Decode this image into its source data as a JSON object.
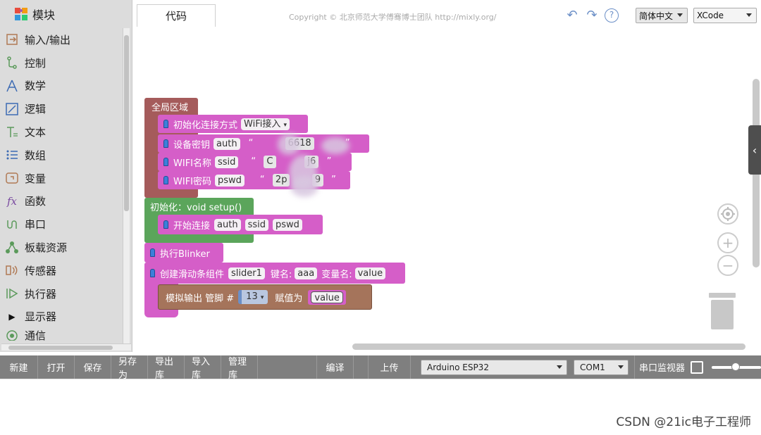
{
  "sidebar": {
    "title": "模块",
    "items": [
      {
        "label": "输入/输出",
        "icon": "input-output-icon"
      },
      {
        "label": "控制",
        "icon": "control-icon"
      },
      {
        "label": "数学",
        "icon": "math-icon"
      },
      {
        "label": "逻辑",
        "icon": "logic-icon"
      },
      {
        "label": "文本",
        "icon": "text-icon"
      },
      {
        "label": "数组",
        "icon": "array-icon"
      },
      {
        "label": "变量",
        "icon": "variable-icon"
      },
      {
        "label": "函数",
        "icon": "function-icon"
      },
      {
        "label": "串口",
        "icon": "serial-icon"
      },
      {
        "label": "板载资源",
        "icon": "board-resource-icon"
      },
      {
        "label": "传感器",
        "icon": "sensor-icon"
      },
      {
        "label": "执行器",
        "icon": "actuator-icon"
      },
      {
        "label": "显示器",
        "icon": "display-icon"
      },
      {
        "label": "通信",
        "icon": "communication-icon"
      }
    ]
  },
  "topbar": {
    "tab_code": "代码",
    "copyright": "Copyright © 北京师范大学傅骞博士团队 http://mixly.org/",
    "language": "简体中文",
    "theme": "XCode"
  },
  "blocks": {
    "global_area": "全局区域",
    "init_conn": "初始化连接方式",
    "init_conn_value": "WiFi接入",
    "device_key": "设备密钥",
    "auth": "auth",
    "auth_value": "6618",
    "wifi_name": "WIFI名称",
    "ssid": "ssid",
    "ssid_value_a": "C",
    "ssid_value_b": "j6",
    "wifi_pwd": "WIFI密码",
    "pswd": "pswd",
    "pswd_value_a": "2p",
    "pswd_value_b": "9",
    "quote_open": "“",
    "quote_close": "”",
    "setup": "初始化：void setup()",
    "start_conn": "开始连接",
    "run_blinker": "执行Blinker",
    "create_slider": "创建滑动条组件",
    "slider_name": "slider1",
    "key_label": "键名:",
    "key_value": "aaa",
    "var_label": "变量名:",
    "var_value": "value",
    "analog_out": "模拟输出 管脚 #",
    "pin": "13",
    "assign": "赋值为",
    "assign_value": "value"
  },
  "bottombar": {
    "new": "新建",
    "open": "打开",
    "save": "保存",
    "save_as": "另存为",
    "export_lib": "导出库",
    "import_lib": "导入库",
    "manage_lib": "管理库",
    "compile": "编译",
    "upload": "上传",
    "board": "Arduino ESP32",
    "port": "COM1",
    "serial_monitor": "串口监视器"
  },
  "watermark": "CSDN @21ic电子工程师",
  "colors": {
    "global_block": "#a55b5b",
    "procedure_block": "#d55ec8",
    "setup_block": "#5ba55b",
    "analog_block": "#a5745b",
    "bottombar": "#7f7f7f",
    "sidebar": "#dcdcdc"
  }
}
